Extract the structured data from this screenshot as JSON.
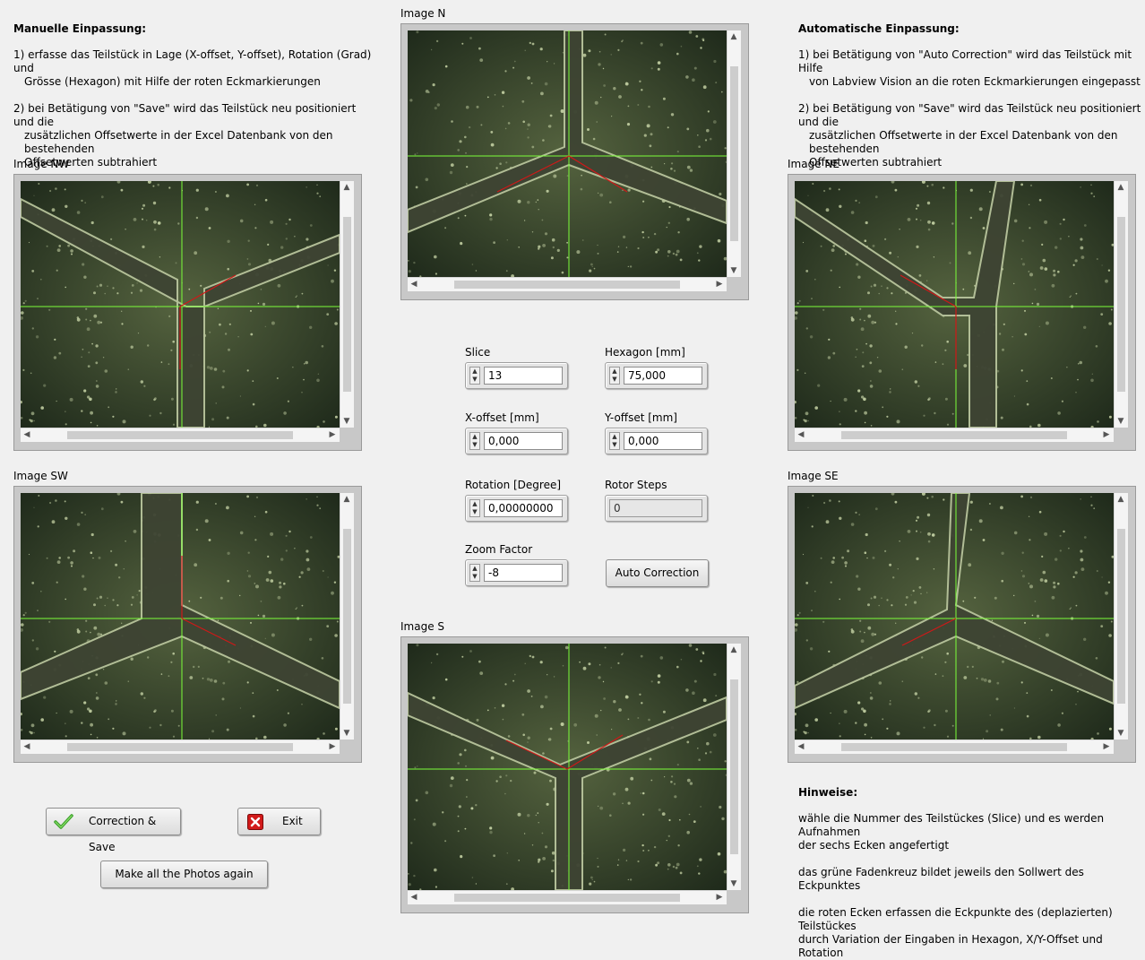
{
  "manual": {
    "title": "Manuelle Einpassung:",
    "step1_line1": "1) erfasse das Teilstück in Lage (X-offset, Y-offset), Rotation (Grad) und",
    "step1_line2": "Grösse (Hexagon) mit Hilfe der roten Eckmarkierungen",
    "step2_line1": "2) bei Betätigung von \"Save\" wird das Teilstück neu positioniert und die",
    "step2_line2": "zusätzlichen Offsetwerte in der Excel Datenbank von den bestehenden",
    "step2_line3": "Offsetwerten subtrahiert"
  },
  "auto": {
    "title": "Automatische Einpassung:",
    "step1_line1": "1) bei Betätigung von \"Auto Correction\" wird das Teilstück mit Hilfe",
    "step1_line2": "von Labview Vision an die roten Eckmarkierungen eingepasst",
    "step2_line1": "2) bei Betätigung von \"Save\" wird das Teilstück neu positioniert und die",
    "step2_line2": "zusätzlichen Offsetwerte in der Excel Datenbank von den bestehenden",
    "step2_line3": "Offsetwerten subtrahiert"
  },
  "images": {
    "nw": "Image NW",
    "n": "Image N",
    "ne": "Image NE",
    "sw": "Image SW",
    "s": "Image S",
    "se": "Image SE"
  },
  "controls": {
    "slice_label": "Slice",
    "slice_value": "13",
    "hexagon_label": "Hexagon [mm]",
    "hexagon_value": "75,000",
    "xoffset_label": "X-offset [mm]",
    "xoffset_value": "0,000",
    "yoffset_label": "Y-offset [mm]",
    "yoffset_value": "0,000",
    "rotation_label": "Rotation [Degree]",
    "rotation_value": "0,00000000",
    "rotor_label": "Rotor Steps",
    "rotor_value": "0",
    "zoom_label": "Zoom Factor",
    "zoom_value": "-8",
    "auto_correction": "Auto Correction"
  },
  "buttons": {
    "correction_save": "Correction & Save",
    "exit": "Exit",
    "make_photos": "Make all the Photos again"
  },
  "hints": {
    "title": "Hinweise:",
    "line1": "wähle die Nummer des  Teilstückes (Slice) und es werden Aufnahmen",
    "line2": "der sechs Ecken angefertigt",
    "line3": "das grüne Fadenkreuz bildet jeweils den Sollwert des Eckpunktes",
    "line4": "die roten Ecken erfassen die Eckpunkte des (deplazierten) Teilstückes",
    "line5": "durch Variation der Eingaben in Hexagon, X/Y-Offset und Rotation"
  },
  "icons": {
    "check": "check-icon",
    "exit": "red-x-icon"
  },
  "colors": {
    "crosshair": "#7cff3a",
    "corner_marker": "#d01818",
    "background": "#f0f0f0"
  }
}
